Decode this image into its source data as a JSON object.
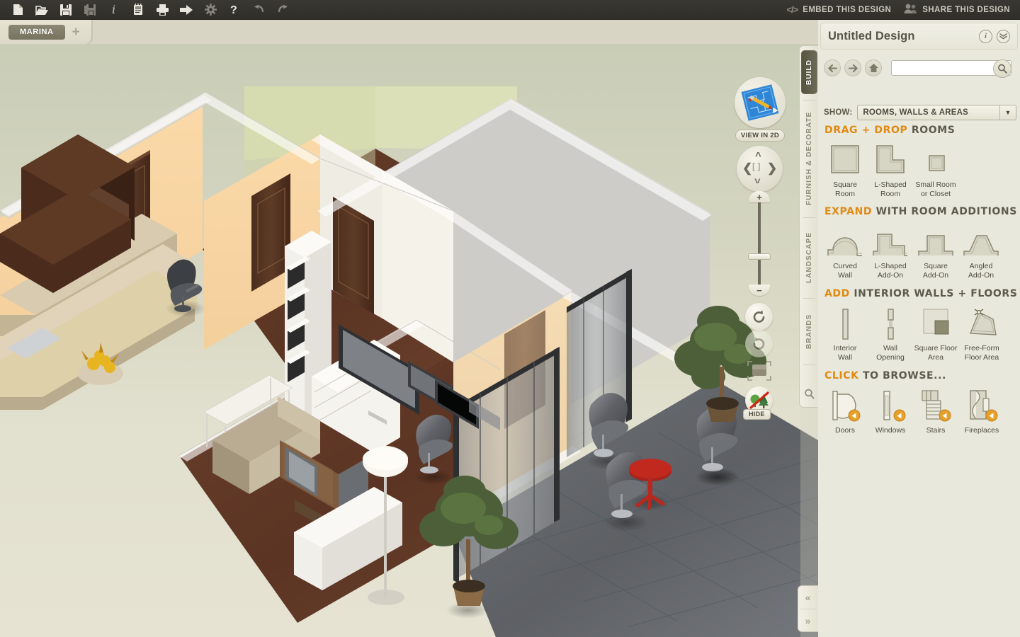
{
  "toolbar": {
    "icons": [
      {
        "name": "new-document-icon",
        "label": "New"
      },
      {
        "name": "open-folder-icon",
        "label": "Open"
      },
      {
        "name": "save-icon",
        "label": "Save"
      },
      {
        "name": "save-as-icon",
        "label": "Save As"
      },
      {
        "name": "info-icon",
        "label": "Info"
      },
      {
        "name": "notes-icon",
        "label": "Notes"
      },
      {
        "name": "print-icon",
        "label": "Print"
      },
      {
        "name": "export-icon",
        "label": "Export"
      },
      {
        "name": "settings-gear-icon",
        "label": "Settings"
      },
      {
        "name": "help-icon",
        "label": "Help"
      },
      {
        "name": "undo-icon",
        "label": "Undo"
      },
      {
        "name": "redo-icon",
        "label": "Redo"
      }
    ],
    "embed_label": "EMBED THIS DESIGN",
    "embed_icon_text": "</>",
    "share_label": "SHARE THIS DESIGN"
  },
  "tabstrip": {
    "project_tab": "MARINA",
    "add_tab": "+"
  },
  "viewport": {
    "view_2d_label": "VIEW IN 2D",
    "hide_label": "HIDE",
    "pad_center": "[ ]",
    "zoom_plus": "+",
    "zoom_minus": "−"
  },
  "vertical_tabs": [
    {
      "label": "BUILD",
      "active": true
    },
    {
      "label": "FURNISH & DECORATE",
      "active": false
    },
    {
      "label": "LANDSCAPE",
      "active": false
    },
    {
      "label": "BRANDS",
      "active": false
    }
  ],
  "panel": {
    "title": "Untitled Design",
    "info_badge": "i",
    "collapse_badge": "»",
    "search_value": "",
    "search_placeholder": "",
    "show_label": "SHOW:",
    "show_value": "ROOMS, WALLS & AREAS",
    "sections": [
      {
        "head_highlight": "DRAG + DROP",
        "head_rest": "ROOMS",
        "items": [
          {
            "icon": "square-room-icon",
            "caption": "Square\nRoom"
          },
          {
            "icon": "l-shaped-room-icon",
            "caption": "L-Shaped\nRoom"
          },
          {
            "icon": "small-room-icon",
            "caption": "Small Room\nor Closet"
          }
        ]
      },
      {
        "head_highlight": "EXPAND",
        "head_rest": "WITH ROOM ADDITIONS",
        "items": [
          {
            "icon": "curved-wall-icon",
            "caption": "Curved\nWall"
          },
          {
            "icon": "l-shaped-addon-icon",
            "caption": "L-Shaped\nAdd-On"
          },
          {
            "icon": "square-addon-icon",
            "caption": "Square\nAdd-On"
          },
          {
            "icon": "angled-addon-icon",
            "caption": "Angled\nAdd-On"
          }
        ]
      },
      {
        "head_highlight": "ADD",
        "head_rest": "INTERIOR WALLS + FLOORS",
        "items": [
          {
            "icon": "interior-wall-icon",
            "caption": "Interior\nWall"
          },
          {
            "icon": "wall-opening-icon",
            "caption": "Wall\nOpening"
          },
          {
            "icon": "square-floor-area-icon",
            "caption": "Square Floor\nArea"
          },
          {
            "icon": "free-form-floor-area-icon",
            "caption": "Free-Form\nFloor Area"
          }
        ]
      },
      {
        "head_highlight": "CLICK",
        "head_rest": "TO BROWSE...",
        "items": [
          {
            "icon": "doors-icon",
            "caption": "Doors",
            "badge": true
          },
          {
            "icon": "windows-icon",
            "caption": "Windows",
            "badge": true
          },
          {
            "icon": "stairs-icon",
            "caption": "Stairs",
            "badge": true
          },
          {
            "icon": "fireplaces-icon",
            "caption": "Fireplaces",
            "badge": true
          }
        ]
      }
    ]
  },
  "collapse": {
    "left_chevron": "«",
    "right_chevron": "»"
  },
  "colors": {
    "toolbar_bg": "#332f2a",
    "panel_bg": "#e8e8dc",
    "accent_orange": "#e08a12",
    "active_tab": "#56533f",
    "canvas_top": "#c9cdb6",
    "canvas_bottom": "#e6e3d3"
  }
}
